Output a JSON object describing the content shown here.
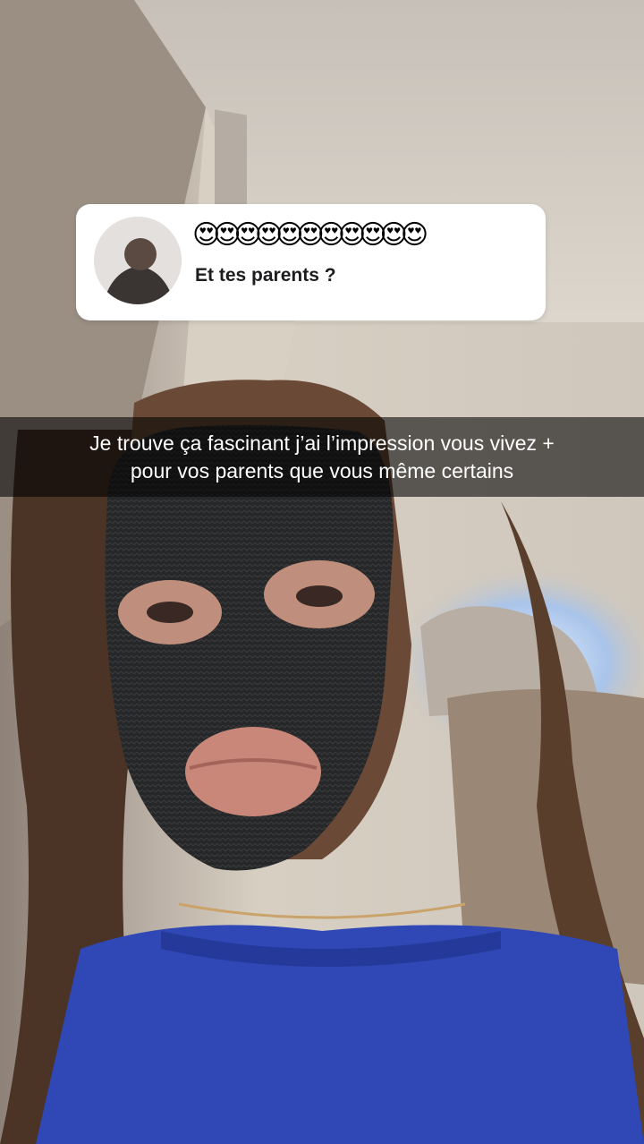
{
  "question_card": {
    "asker_name": "😍😍😍😍😍😍😍😍😍😍😍",
    "question": "Et tes parents ?"
  },
  "caption": {
    "line1": "Je trouve ça fascinant j’ai l’impression vous vivez +",
    "line2": "pour vos parents que vous même certains"
  }
}
